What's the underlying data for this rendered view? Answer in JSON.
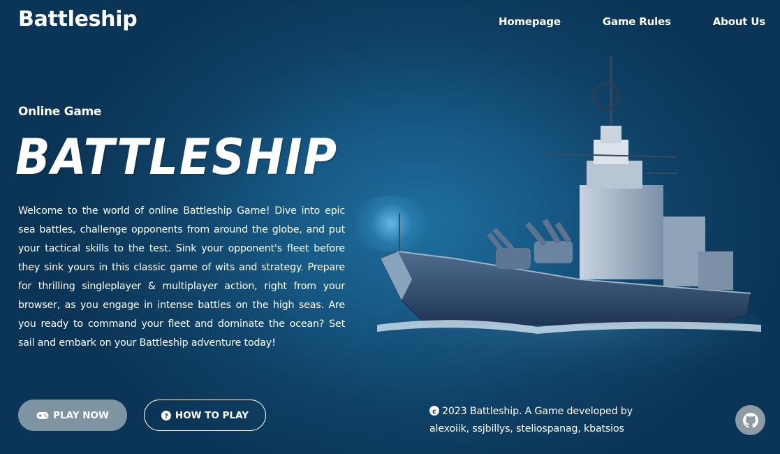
{
  "header": {
    "logo": "Battleship",
    "nav": [
      {
        "label": "Homepage"
      },
      {
        "label": "Game Rules"
      },
      {
        "label": "About Us"
      }
    ]
  },
  "hero": {
    "subtitle": "Online Game",
    "title": "BATTLESHIP",
    "description": "Welcome to the world of online Battleship Game! Dive into epic sea battles, challenge opponents from around the globe, and put your tactical skills to the test. Sink your opponent's fleet before they sink yours in this classic game of wits and strategy. Prepare for thrilling singleplayer & multiplayer action, right from your browser, as you engage in intense battles on the high seas. Are you ready to command your fleet and dominate the ocean? Set sail and embark on your Battleship adventure today!",
    "buttons": {
      "play": {
        "label": "PLAY NOW",
        "icon": "gamepad-icon"
      },
      "how": {
        "label": "HOW TO PLAY",
        "icon": "question-circle-icon"
      }
    }
  },
  "footer": {
    "line1": "2023 Battleship. A Game developed by",
    "line2": "alexoiik, ssjbillys, steliospanag, kbatsios",
    "copyright_icon": "copyright-icon",
    "github_icon": "github-icon"
  },
  "colors": {
    "background": "#0f4166",
    "play_button": "#7e94a3",
    "github_button": "#8e9ba5"
  }
}
